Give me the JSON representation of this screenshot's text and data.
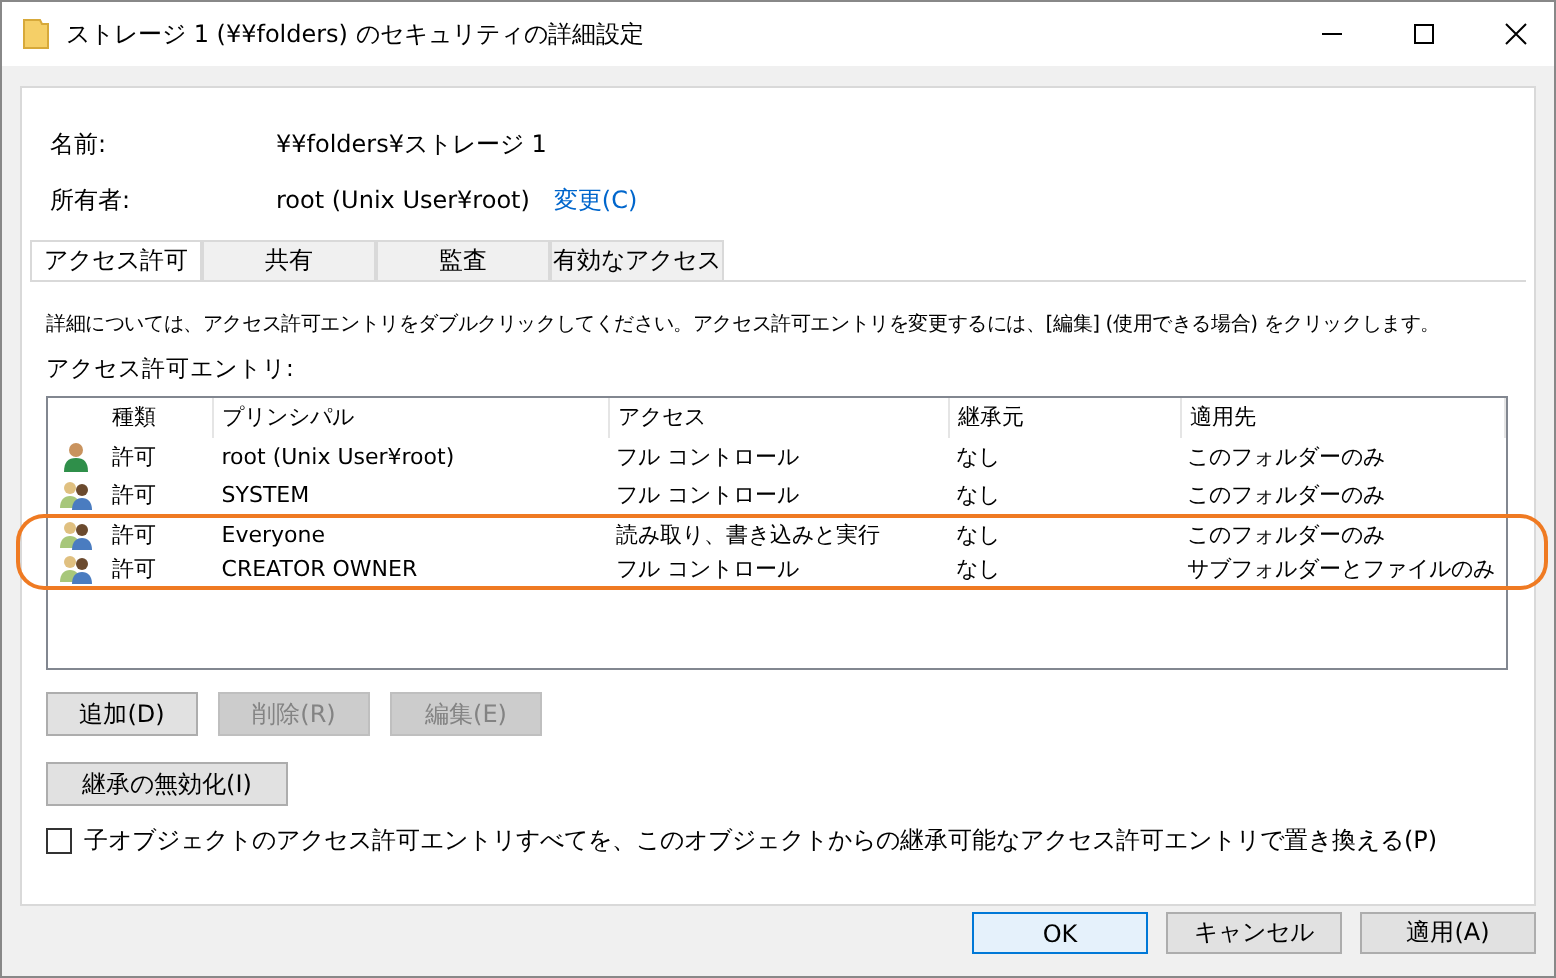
{
  "window": {
    "title": "ストレージ 1  (¥¥folders) のセキュリティの詳細設定"
  },
  "name": {
    "label": "名前:",
    "value": "¥¥folders¥ストレージ 1"
  },
  "owner": {
    "label": "所有者:",
    "value": "root (Unix User¥root)",
    "link": "変更(C)"
  },
  "tabs": [
    {
      "label": "アクセス許可",
      "selected": true
    },
    {
      "label": "共有",
      "selected": false
    },
    {
      "label": "監査",
      "selected": false
    },
    {
      "label": "有効なアクセス",
      "selected": false
    }
  ],
  "description": "詳細については、アクセス許可エントリをダブルクリックしてください。アクセス許可エントリを変更するには、[編集] (使用できる場合) をクリックします。",
  "entries_label": "アクセス許可エントリ:",
  "table": {
    "columns": [
      "種類",
      "プリンシパル",
      "アクセス",
      "継承元",
      "適用先"
    ],
    "rows": [
      {
        "kind": "user",
        "highlighted": false,
        "cells": [
          "許可",
          "root (Unix User¥root)",
          "フル コントロール",
          "なし",
          "このフォルダーのみ"
        ]
      },
      {
        "kind": "group",
        "highlighted": false,
        "cells": [
          "許可",
          "SYSTEM",
          "フル コントロール",
          "なし",
          "このフォルダーのみ"
        ]
      },
      {
        "kind": "group",
        "highlighted": true,
        "cells": [
          "許可",
          "Everyone",
          "読み取り、書き込みと実行",
          "なし",
          "このフォルダーのみ"
        ]
      },
      {
        "kind": "group",
        "highlighted": true,
        "cells": [
          "許可",
          "CREATOR OWNER",
          "フル コントロール",
          "なし",
          "サブフォルダーとファイルのみ"
        ]
      }
    ]
  },
  "entry_buttons": [
    {
      "label": "追加(D)",
      "disabled": false
    },
    {
      "label": "削除(R)",
      "disabled": true
    },
    {
      "label": "編集(E)",
      "disabled": true
    }
  ],
  "inheritance_button": "継承の無効化(I)",
  "replace_checkbox": {
    "label": "子オブジェクトのアクセス許可エントリすべてを、このオブジェクトからの継承可能なアクセス許可エントリで置き換える(P)",
    "checked": false
  },
  "dialog_buttons": [
    {
      "label": "OK",
      "default": true
    },
    {
      "label": "キャンセル",
      "default": false
    },
    {
      "label": "適用(A)",
      "default": false
    }
  ]
}
